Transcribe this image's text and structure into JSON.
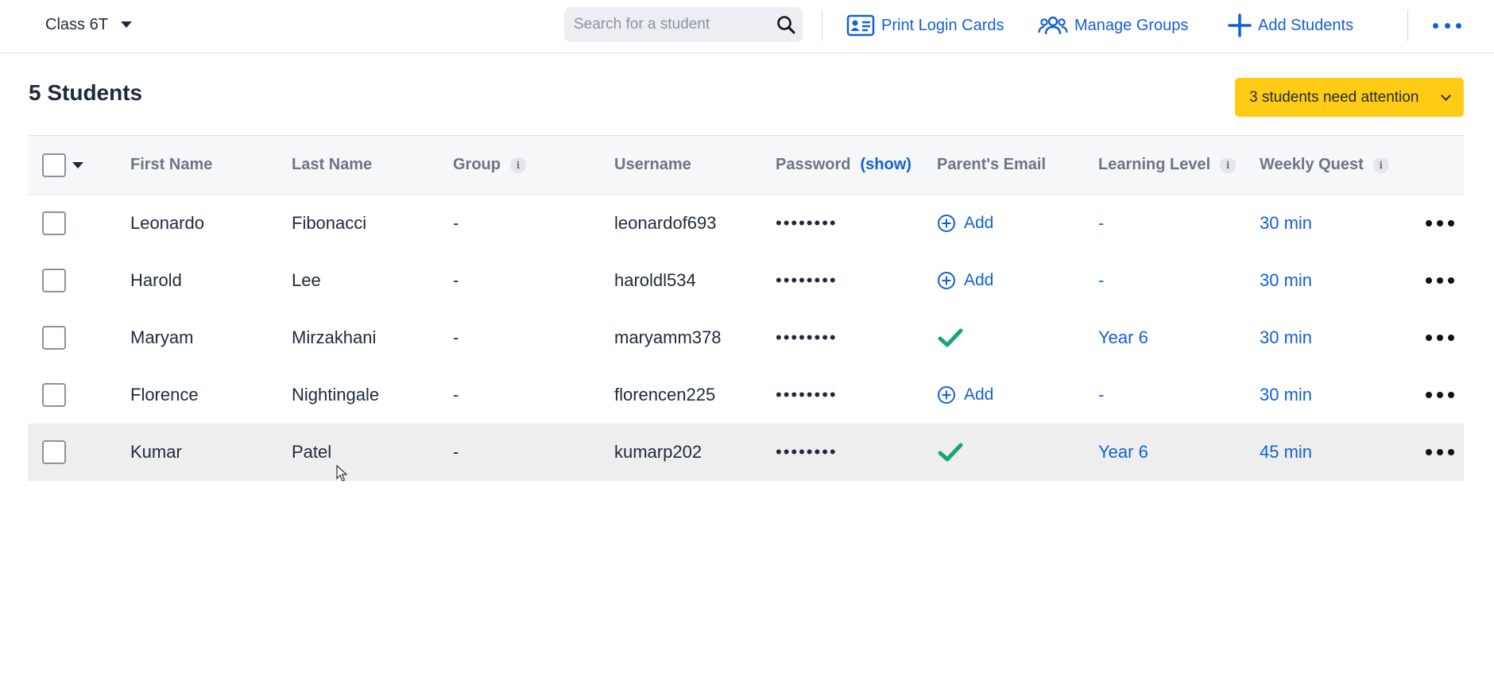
{
  "topbar": {
    "class_name": "Class 6T",
    "search_placeholder": "Search for a student",
    "print_cards": "Print Login Cards",
    "manage_groups": "Manage Groups",
    "add_students": "Add Students"
  },
  "header": {
    "count_title": "5 Students",
    "attention": "3 students need attention"
  },
  "table": {
    "columns": {
      "first_name": "First Name",
      "last_name": "Last Name",
      "group": "Group",
      "username": "Username",
      "password": "Password",
      "show": "(show)",
      "parent_email": "Parent's Email",
      "learning_level": "Learning Level",
      "weekly_quest": "Weekly Quest"
    },
    "add_label": "Add",
    "password_mask": "••••••••",
    "rows": [
      {
        "first": "Leonardo",
        "last": "Fibonacci",
        "group": "-",
        "username": "leonardof693",
        "email_status": "add",
        "level": "-",
        "quest": "30 min"
      },
      {
        "first": "Harold",
        "last": "Lee",
        "group": "-",
        "username": "haroldl534",
        "email_status": "add",
        "level": "-",
        "quest": "30 min"
      },
      {
        "first": "Maryam",
        "last": "Mirzakhani",
        "group": "-",
        "username": "maryamm378",
        "email_status": "set",
        "level": "Year 6",
        "quest": "30 min"
      },
      {
        "first": "Florence",
        "last": "Nightingale",
        "group": "-",
        "username": "florencen225",
        "email_status": "add",
        "level": "-",
        "quest": "30 min"
      },
      {
        "first": "Kumar",
        "last": "Patel",
        "group": "-",
        "username": "kumarp202",
        "email_status": "set",
        "level": "Year 6",
        "quest": "45 min"
      }
    ]
  },
  "colors": {
    "accent": "#1360d6",
    "attention": "#ffcc15",
    "check": "#1aa37a",
    "text": "#1e2a3b"
  }
}
